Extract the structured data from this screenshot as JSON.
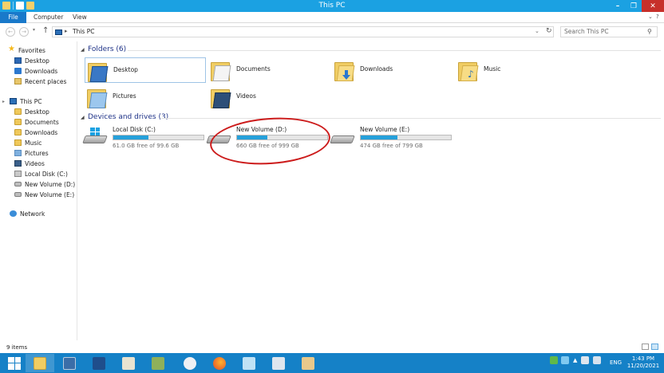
{
  "window": {
    "title": "This PC"
  },
  "ribbon": {
    "tabs": {
      "file": "File",
      "computer": "Computer",
      "view": "View"
    }
  },
  "address": {
    "path_label": "This PC",
    "search_placeholder": "Search This PC"
  },
  "nav": {
    "favorites": "Favorites",
    "desktop": "Desktop",
    "downloads": "Downloads",
    "recent": "Recent places",
    "this_pc": "This PC",
    "pc_desktop": "Desktop",
    "pc_documents": "Documents",
    "pc_downloads": "Downloads",
    "pc_music": "Music",
    "pc_pictures": "Pictures",
    "pc_videos": "Videos",
    "pc_local_c": "Local Disk (C:)",
    "pc_volume_d": "New Volume (D:)",
    "pc_volume_e": "New Volume (E:)",
    "network": "Network"
  },
  "folders": {
    "header": "Folders (6)",
    "items": [
      "Desktop",
      "Documents",
      "Downloads",
      "Music",
      "Pictures",
      "Videos"
    ]
  },
  "drives": {
    "header": "Devices and drives (3)",
    "items": [
      {
        "name": "Local Disk (C:)",
        "free": "61.0 GB free of 99.6 GB",
        "used_fraction": 0.39
      },
      {
        "name": "New Volume (D:)",
        "free": "660 GB free of 999 GB",
        "used_fraction": 0.34
      },
      {
        "name": "New Volume (E:)",
        "free": "474 GB free of 799 GB",
        "used_fraction": 0.41
      }
    ]
  },
  "status": {
    "items_count": "9 items"
  },
  "tray": {
    "language": "ENG"
  },
  "clock": {
    "time": "1:43 PM",
    "date": "11/20/2021"
  },
  "colors": {
    "titlebar": "#1ba1e2",
    "taskbar": "#1581c7",
    "accent": "#26a0da",
    "annotation": "#cc1b1b"
  }
}
